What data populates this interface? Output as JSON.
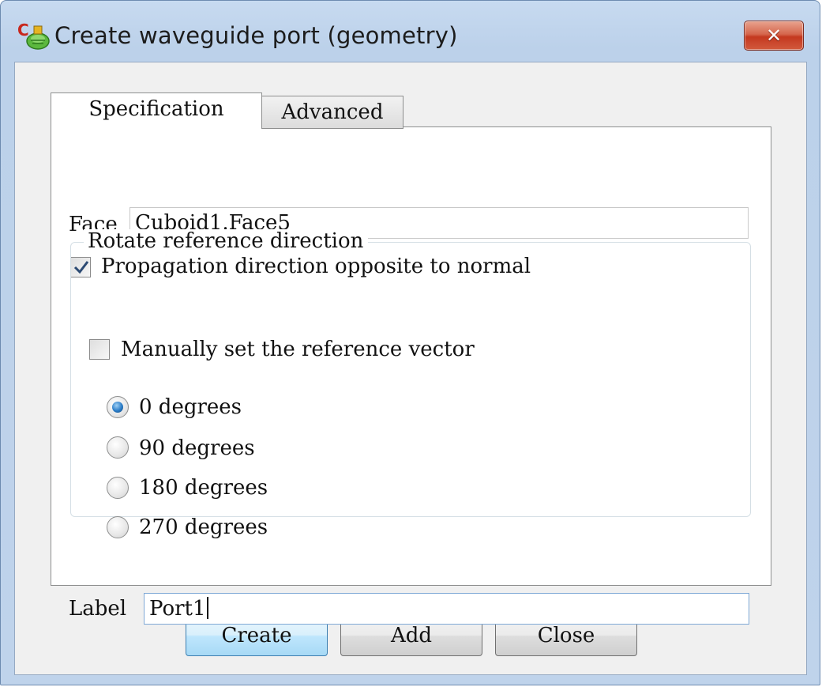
{
  "window": {
    "title": "Create waveguide port (geometry)",
    "close_glyph": "✕"
  },
  "tabs": [
    {
      "label": "Specification",
      "selected": true
    },
    {
      "label": "Advanced",
      "selected": false
    }
  ],
  "specification": {
    "face_label": "Face",
    "face_value": "Cuboid1.Face5",
    "propagation_label": "Propagation direction opposite to normal",
    "propagation_checked": true,
    "rotate_group_title": "Rotate reference direction",
    "manual_vector_label": "Manually set the reference vector",
    "manual_vector_checked": false,
    "rotation_options": [
      {
        "label": "0 degrees",
        "selected": true
      },
      {
        "label": "90 degrees",
        "selected": false
      },
      {
        "label": "180 degrees",
        "selected": false
      },
      {
        "label": "270 degrees",
        "selected": false
      }
    ],
    "label_label": "Label",
    "label_value": "Port1"
  },
  "buttons": {
    "create": "Create",
    "add": "Add",
    "close": "Close"
  },
  "icons": {
    "app": "cst-app-icon",
    "check": "checkmark-icon"
  }
}
